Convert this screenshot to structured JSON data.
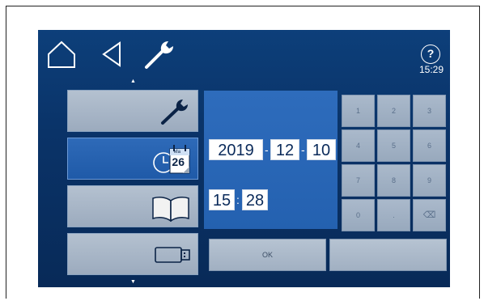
{
  "topbar": {
    "home_icon": "home-icon",
    "back_icon": "back-triangle-icon",
    "settings_icon": "wrench-icon",
    "help_label": "?",
    "clock": "15:29"
  },
  "menu": {
    "scroll_up": "▲",
    "scroll_down": "▼",
    "items": [
      {
        "label": "",
        "icon": "wrench-icon",
        "active": false
      },
      {
        "label": "",
        "icon": "clock-calendar-icon",
        "calendar_month": "Ma",
        "calendar_day": "26",
        "active": true
      },
      {
        "label": "",
        "icon": "book-icon",
        "active": false
      },
      {
        "label": "",
        "icon": "usb-drive-icon",
        "active": false
      }
    ]
  },
  "datetime": {
    "date_label": "",
    "time_label": "",
    "year": "2019",
    "month": "12",
    "day": "10",
    "date_sep": "-",
    "hour": "15",
    "minute": "28",
    "time_sep": ":"
  },
  "keypad": {
    "keys": [
      "1",
      "2",
      "3",
      "4",
      "5",
      "6",
      "7",
      "8",
      "9",
      "0",
      ".",
      "⌫"
    ]
  },
  "buttons": {
    "ok": "OK",
    "cancel": ""
  },
  "colors": {
    "screen_bg": "#0a3368",
    "panel_bg": "#2e6cbc",
    "active_item": "#2e6ab8",
    "inactive_item": "#a9b7c8"
  }
}
